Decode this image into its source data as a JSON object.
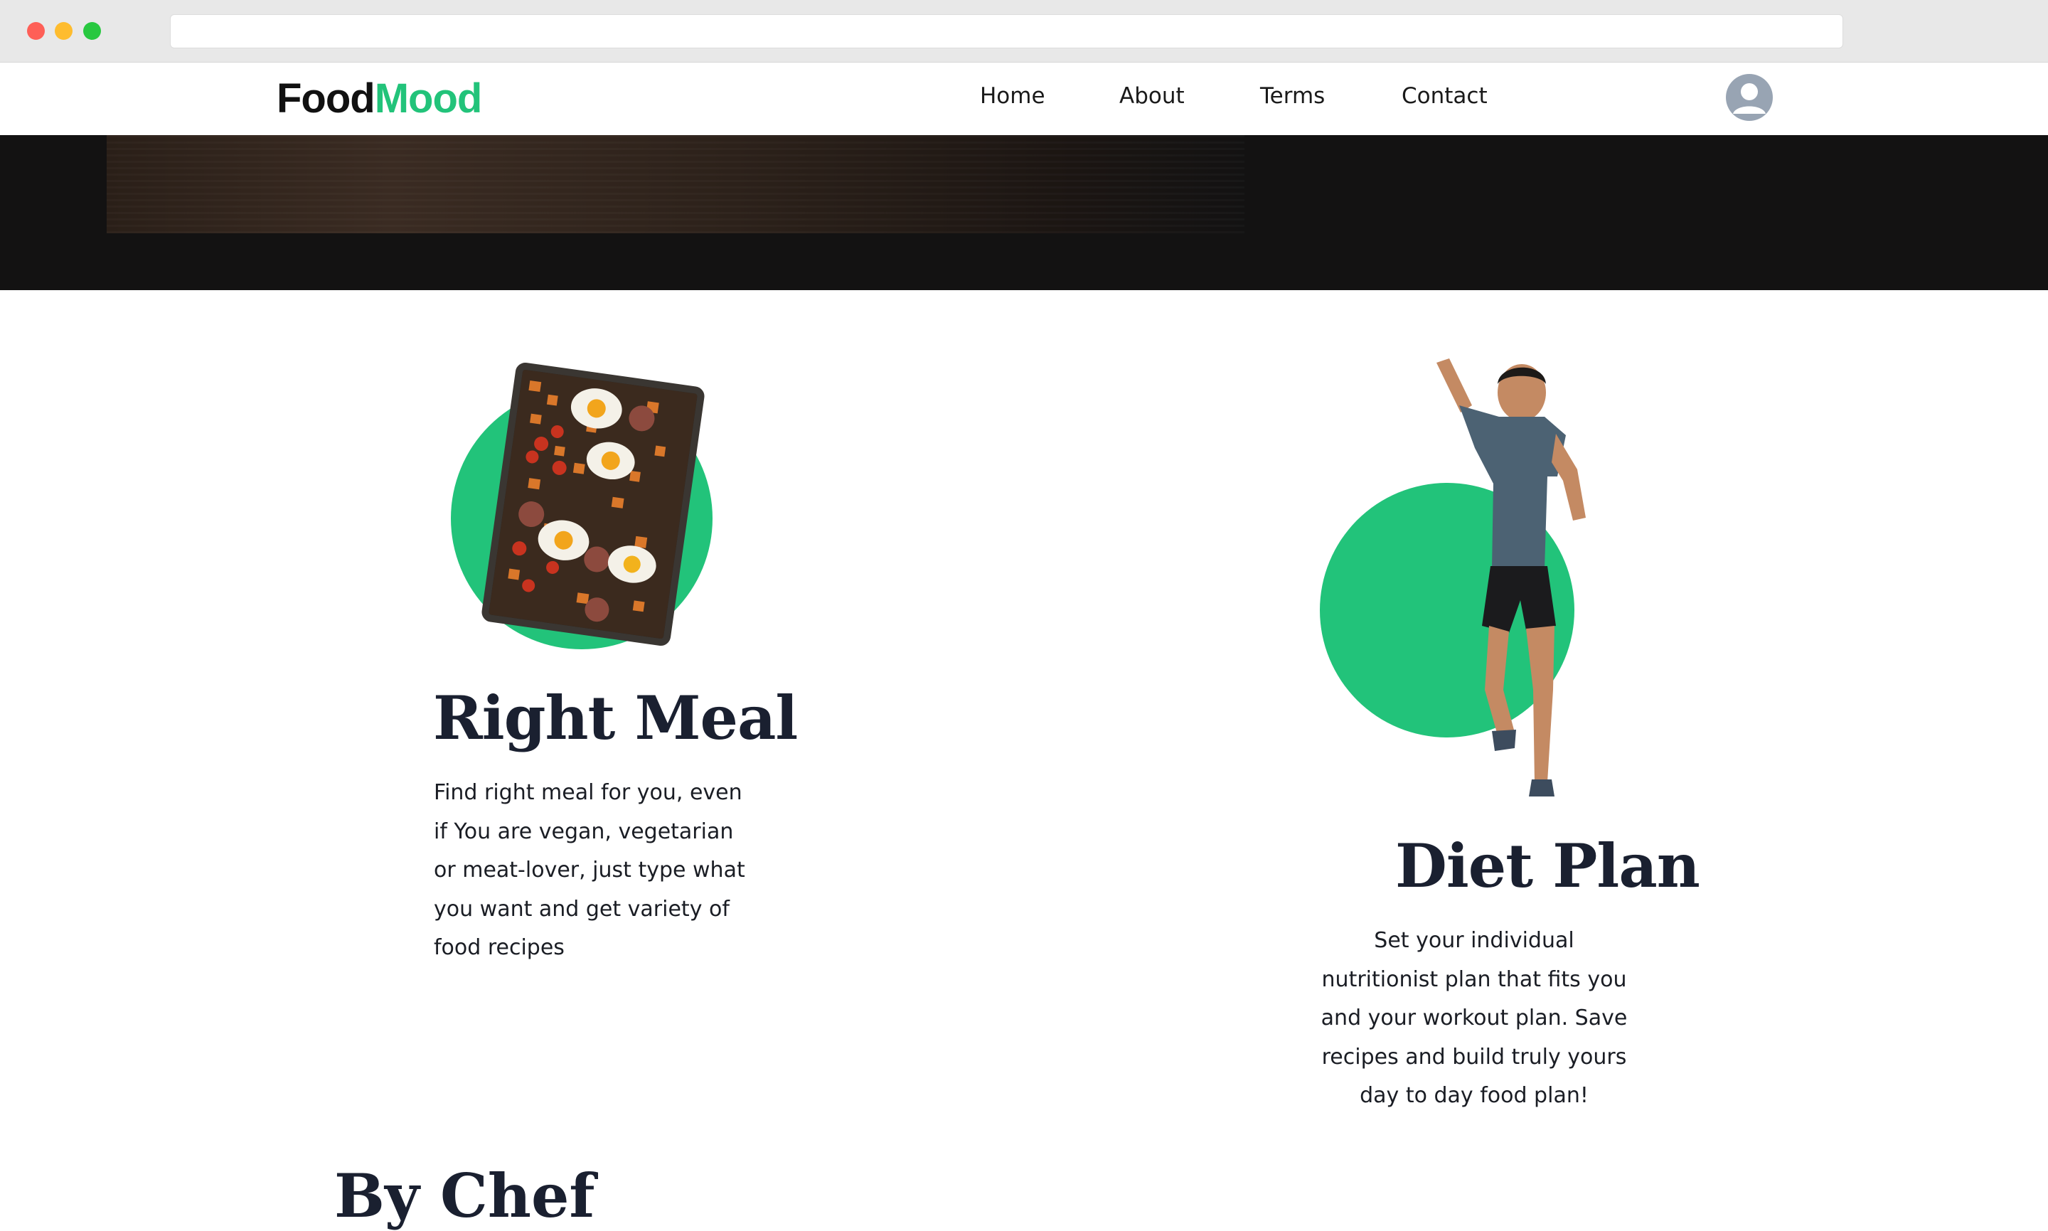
{
  "browser": {
    "address_value": ""
  },
  "nav": {
    "logo_part1": "Food",
    "logo_part2": "Mood",
    "links": [
      "Home",
      "About",
      "Terms",
      "Contact"
    ]
  },
  "features": [
    {
      "title": "Right Meal",
      "text": "Find right meal for you, even if You are vegan, vegetarian or meat-lover, just type what you want and get variety of food recipes"
    },
    {
      "title": "Diet Plan",
      "text": "Set your individual nutritionist plan that fits you and your workout plan. Save recipes and build truly yours day to day food plan!"
    }
  ],
  "next_section_heading": "By Chef",
  "colors": {
    "brand_green": "#22c37a",
    "dark": "#1a2030",
    "hero_bg": "#131212"
  }
}
